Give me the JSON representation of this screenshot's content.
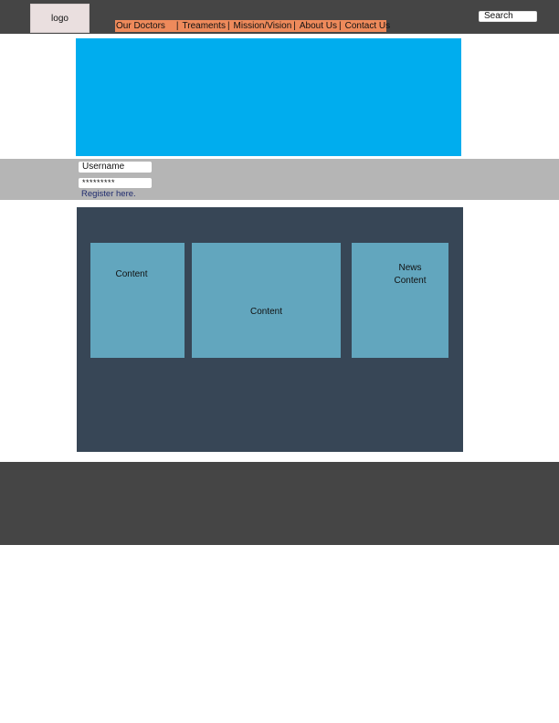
{
  "header": {
    "logo_text": "logo",
    "search_label": "Search"
  },
  "nav": {
    "items": [
      {
        "label": "Our Doctors"
      },
      {
        "label": "Treaments"
      },
      {
        "label": "Mission/Vision"
      },
      {
        "label": "About Us"
      },
      {
        "label": "Contact Us"
      }
    ],
    "separator": "|"
  },
  "login": {
    "username_value": "Username",
    "password_value": "*********",
    "register_link": "Register here."
  },
  "content": {
    "panels": [
      {
        "label": "Content"
      },
      {
        "label": "Content"
      },
      {
        "label_line1": "News",
        "label_line2": "Content"
      }
    ]
  },
  "colors": {
    "header_bg": "#454545",
    "nav_bg": "#ee8a5b",
    "banner_bg": "#00adee",
    "login_strip_bg": "#b5b5b5",
    "content_area_bg": "#374656",
    "panel_bg": "#62a6be",
    "footer_bg": "#454545",
    "logo_bg": "#eadfdf"
  }
}
